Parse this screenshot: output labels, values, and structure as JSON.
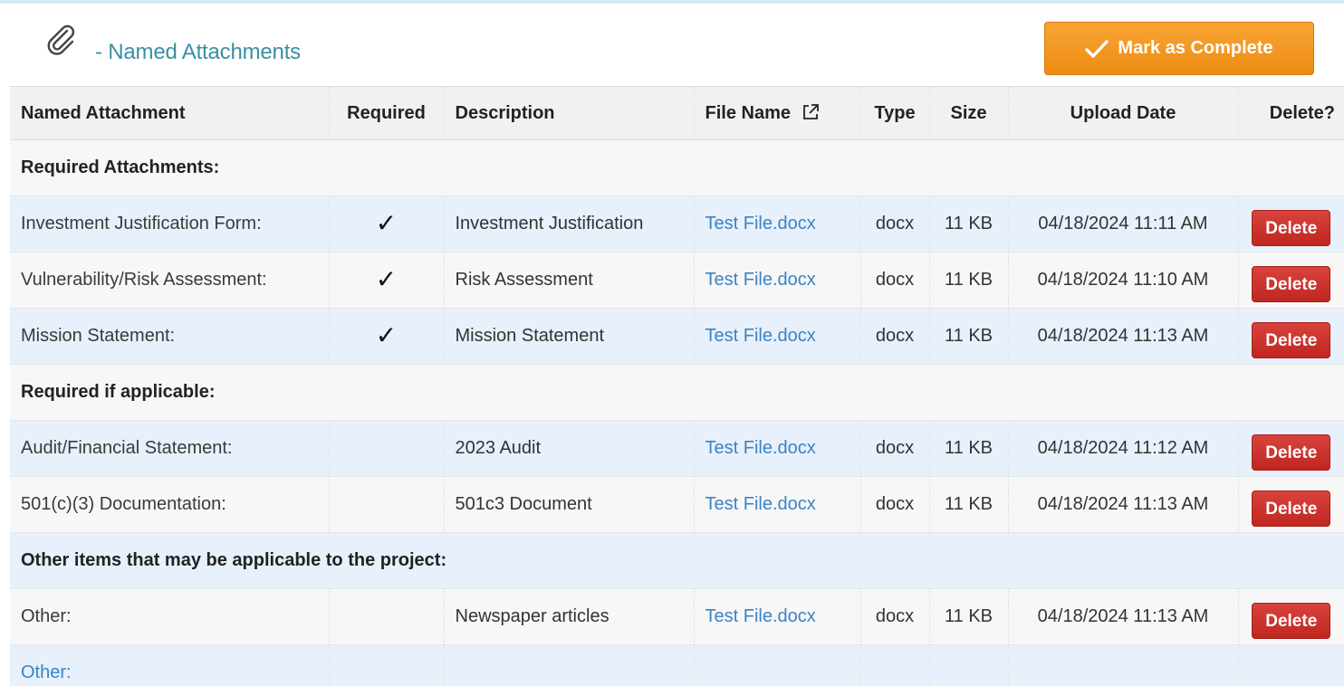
{
  "header": {
    "title": "- Named Attachments",
    "complete_label": "Mark as Complete",
    "accent_color": "#3a8fa3",
    "button_color": "#ee8c12"
  },
  "columns": {
    "name": "Named Attachment",
    "required": "Required",
    "description": "Description",
    "file": "File Name",
    "type": "Type",
    "size": "Size",
    "date": "Upload Date",
    "delete": "Delete?"
  },
  "groups": [
    {
      "label": "Required Attachments:",
      "rows": [
        {
          "name": "Investment Justification Form:",
          "required": true,
          "description": "Investment Justification",
          "file": "Test File.docx",
          "type": "docx",
          "size": "11 KB",
          "date": "04/18/2024 11:11 AM",
          "delete": "Delete"
        },
        {
          "name": "Vulnerability/Risk Assessment:",
          "required": true,
          "description": "Risk Assessment",
          "file": "Test File.docx",
          "type": "docx",
          "size": "11 KB",
          "date": "04/18/2024 11:10 AM",
          "delete": "Delete"
        },
        {
          "name": "Mission Statement:",
          "required": true,
          "description": "Mission Statement",
          "file": "Test File.docx",
          "type": "docx",
          "size": "11 KB",
          "date": "04/18/2024 11:13 AM",
          "delete": "Delete"
        }
      ]
    },
    {
      "label": "Required if applicable:",
      "rows": [
        {
          "name": "Audit/Financial Statement:",
          "required": false,
          "description": "2023 Audit",
          "file": "Test File.docx",
          "type": "docx",
          "size": "11 KB",
          "date": "04/18/2024 11:12 AM",
          "delete": "Delete"
        },
        {
          "name": "501(c)(3) Documentation:",
          "required": false,
          "description": "501c3 Document",
          "file": "Test File.docx",
          "type": "docx",
          "size": "11 KB",
          "date": "04/18/2024 11:13 AM",
          "delete": "Delete"
        }
      ]
    },
    {
      "label": "Other items that may be applicable to the project:",
      "rows": [
        {
          "name": "Other:",
          "required": false,
          "description": "Newspaper articles",
          "file": "Test File.docx",
          "type": "docx",
          "size": "11 KB",
          "date": "04/18/2024 11:13 AM",
          "delete": "Delete"
        }
      ]
    }
  ],
  "empty_row": {
    "name": "Other:"
  },
  "check_glyph": "✓",
  "delete_color": "#c9302c",
  "link_color": "#3b84c4"
}
